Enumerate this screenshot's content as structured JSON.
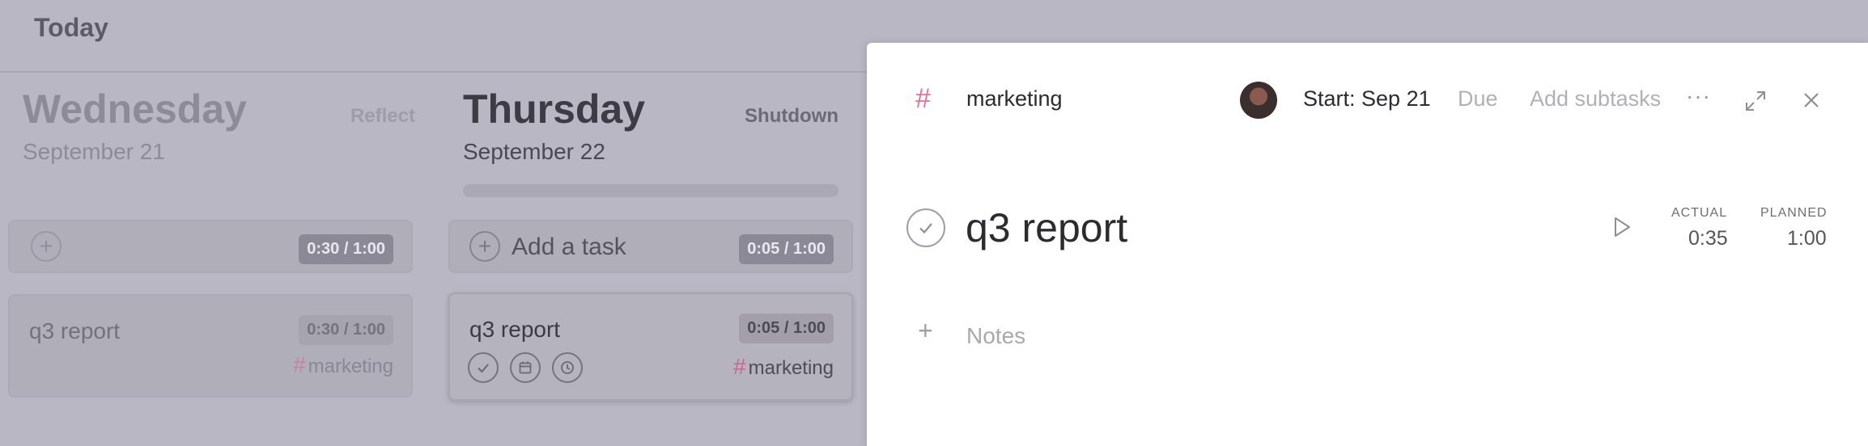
{
  "header": {
    "title": "Today"
  },
  "days": [
    {
      "name": "Wednesday",
      "date": "September 21",
      "action": "Reflect",
      "add_row": {
        "label": "",
        "time": "0:30 / 1:00"
      },
      "task": {
        "title": "q3 report",
        "time": "0:30 / 1:00",
        "tag": "marketing"
      }
    },
    {
      "name": "Thursday",
      "date": "September 22",
      "action": "Shutdown",
      "add_row": {
        "label": "Add a task",
        "time": "0:05 / 1:00"
      },
      "task": {
        "title": "q3 report",
        "time": "0:05 / 1:00",
        "tag": "marketing"
      }
    }
  ],
  "detail": {
    "channel": "marketing",
    "start": "Start: Sep 21",
    "due": "Due",
    "add_subtasks": "Add subtasks",
    "title": "q3 report",
    "actual_label": "ACTUAL",
    "actual_value": "0:35",
    "planned_label": "PLANNED",
    "planned_value": "1:00",
    "notes_placeholder": "Notes"
  },
  "icons": {
    "hash": "#",
    "plus": "+",
    "more": "···"
  },
  "colors": {
    "tag_accent": "#e0709a",
    "overlay_bg": "#b9b7c3",
    "panel_bg": "#ffffff"
  }
}
